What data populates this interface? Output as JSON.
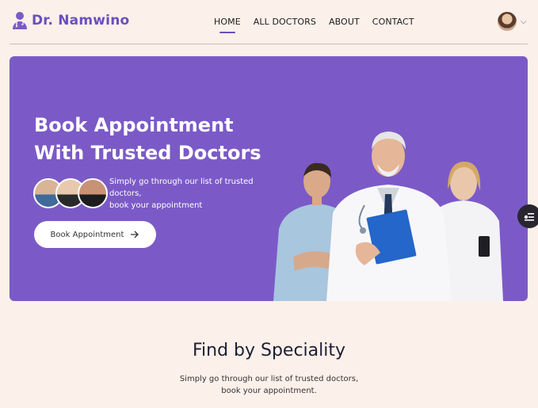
{
  "brand": {
    "name": "Dr. Namwino",
    "accent": "#6b4fbf"
  },
  "nav": {
    "items": [
      {
        "label": "HOME",
        "active": true
      },
      {
        "label": "ALL DOCTORS",
        "active": false
      },
      {
        "label": "ABOUT",
        "active": false
      },
      {
        "label": "CONTACT",
        "active": false
      }
    ]
  },
  "hero": {
    "title_line1": "Book Appointment",
    "title_line2": "With Trusted Doctors",
    "subtitle_line1": "Simply go through our list of trusted doctors,",
    "subtitle_line2": "book your appointment",
    "button_label": "Book Appointment",
    "background": "#7b5ac7"
  },
  "speciality": {
    "heading": "Find by Speciality",
    "text_line1": "Simply go through our list of trusted doctors,",
    "text_line2": "book your appointment."
  },
  "icons": [
    "doctor-logo-icon",
    "profile-avatar",
    "chevron-down-icon",
    "arrow-right-icon",
    "settings-sliders-icon"
  ]
}
